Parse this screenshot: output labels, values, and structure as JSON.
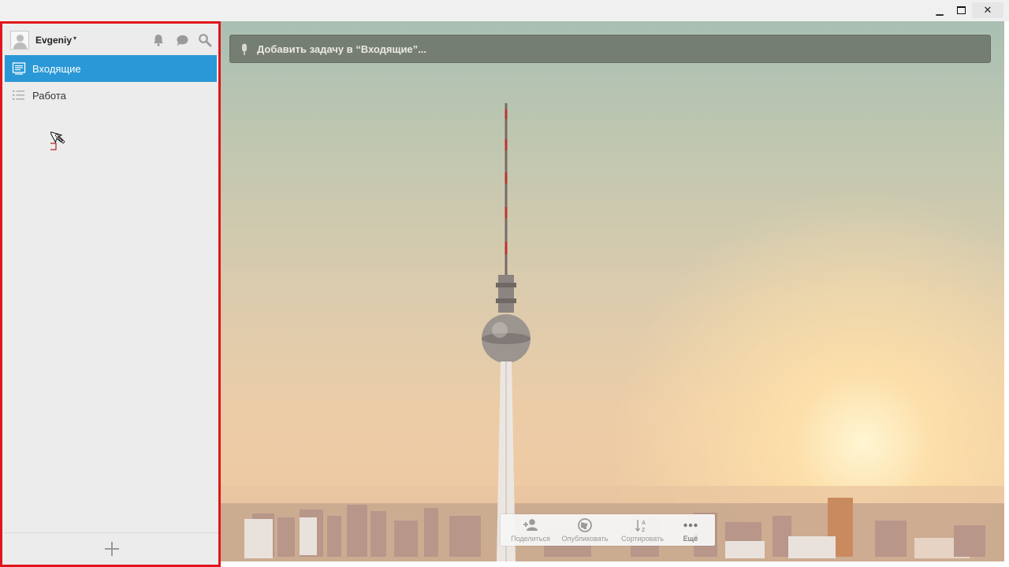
{
  "window": {
    "controls": {
      "minimize": "▁",
      "close": "✕"
    }
  },
  "sidebar": {
    "user": {
      "name": "Evgeniy",
      "caret": "▾"
    },
    "header_icons": [
      "bell-icon",
      "chat-bubble-icon",
      "search-icon"
    ],
    "lists": [
      {
        "label": "Входящие",
        "icon": "inbox-icon",
        "active": true
      },
      {
        "label": "Работа",
        "icon": "list-icon",
        "active": false
      }
    ],
    "footer": {
      "add_icon": "plus-icon"
    }
  },
  "main": {
    "add_task_placeholder": "Добавить задачу в “Входящие”...",
    "background": "berlin-tv-tower-photo",
    "toolbar": [
      {
        "label": "Поделиться",
        "icon": "add-person-icon"
      },
      {
        "label": "Опубликовать",
        "icon": "globe-icon"
      },
      {
        "label": "Сортировать",
        "icon": "sort-az-icon"
      },
      {
        "label": "Ещё",
        "icon": "more-dots-icon"
      }
    ]
  },
  "colors": {
    "accent": "#2a98d6",
    "highlight_border": "#e0161d",
    "sidebar_bg": "#ececec"
  }
}
